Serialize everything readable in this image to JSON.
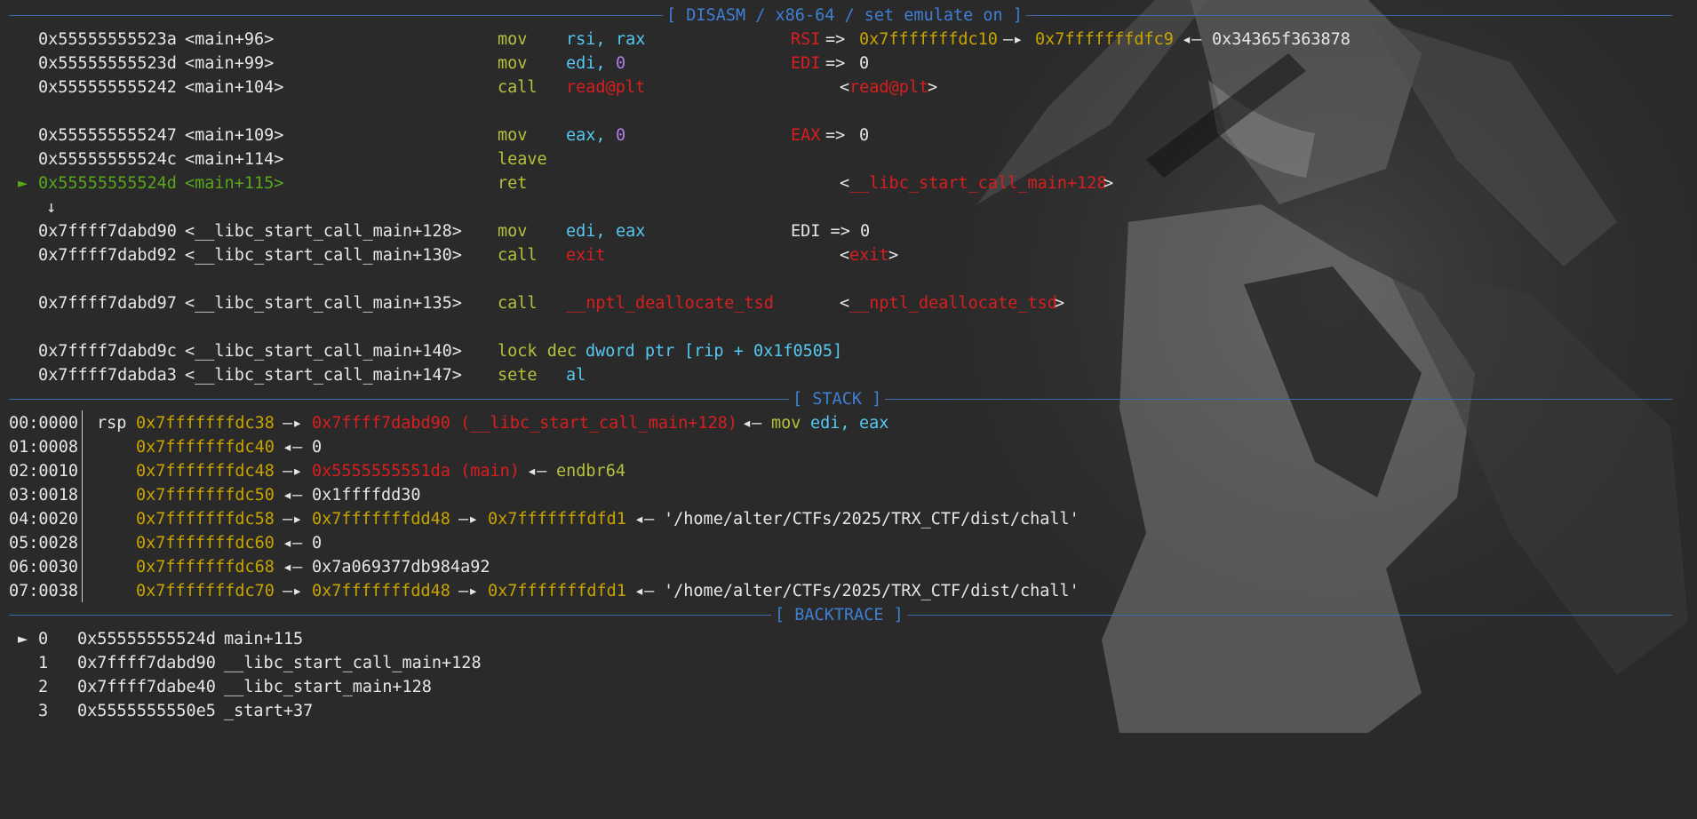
{
  "headers": {
    "disasm": "[ DISASM / x86-64 / set emulate on ]",
    "stack": "[ STACK ]",
    "backtrace": "[ BACKTRACE ]"
  },
  "colors": {
    "address_yellow": "#c8a400",
    "symbol_red": "#d81e1e",
    "current_green": "#58a61a",
    "register_cyan": "#55c8f0",
    "mnemonic_olive": "#b5c13a",
    "immediate_purple": "#b07ce8",
    "separator_blue": "#3f7fd4",
    "background": "#2a2a2b"
  },
  "disasm": {
    "current_marker": "►",
    "jump_arrow": "↓",
    "lines": [
      {
        "addr": "0x55555555523a",
        "sym": "<main+96>",
        "mnem": "mov",
        "op1": "rsi,",
        "op2": "rax",
        "ann_reg": "RSI",
        "ann_arrow": "=>",
        "ann_v1": "0x7fffffffdc10",
        "ann_a1": "—▸",
        "ann_v2": "0x7fffffffdfc9",
        "ann_a2": "◂—",
        "ann_v3": "0x34365f363878"
      },
      {
        "addr": "0x55555555523d",
        "sym": "<main+99>",
        "mnem": "mov",
        "op1": "edi,",
        "op2": "0",
        "ann_reg": "EDI",
        "ann_arrow": "=>",
        "ann_v1": "0"
      },
      {
        "addr": "0x555555555242",
        "sym": "<main+104>",
        "mnem": "call",
        "op1": "read@plt",
        "tgt_open": "<",
        "tgt": "read@plt",
        "tgt_close": ">"
      },
      {
        "addr": "0x555555555247",
        "sym": "<main+109>",
        "mnem": "mov",
        "op1": "eax,",
        "op2": "0",
        "ann_reg": "EAX",
        "ann_arrow": "=>",
        "ann_v1": "0"
      },
      {
        "addr": "0x55555555524c",
        "sym": "<main+114>",
        "mnem": "leave"
      },
      {
        "addr": "0x55555555524d",
        "sym": "<main+115>",
        "mnem": "ret",
        "tgt_open": "<",
        "tgt": "__libc_start_call_main+128",
        "tgt_close": ">"
      },
      {
        "addr": "0x7ffff7dabd90",
        "sym": "<__libc_start_call_main+128>",
        "mnem": "mov",
        "op1": "edi,",
        "op2": "eax",
        "ann_text": "EDI => 0"
      },
      {
        "addr": "0x7ffff7dabd92",
        "sym": "<__libc_start_call_main+130>",
        "mnem": "call",
        "op1": "exit",
        "tgt_open": "<",
        "tgt": "exit",
        "tgt_close": ">"
      },
      {
        "addr": "0x7ffff7dabd97",
        "sym": "<__libc_start_call_main+135>",
        "mnem": "call",
        "op1": "__nptl_deallocate_tsd",
        "tgt_open": "<",
        "tgt": "__nptl_deallocate_tsd",
        "tgt_close": ">"
      },
      {
        "addr": "0x7ffff7dabd9c",
        "sym": "<__libc_start_call_main+140>",
        "mnem": "lock dec",
        "op1": "dword ptr",
        "op2": "[rip + 0x1f0505]"
      },
      {
        "addr": "0x7ffff7dabda3",
        "sym": "<__libc_start_call_main+147>",
        "mnem": "sete",
        "op1": "al"
      }
    ]
  },
  "stack": {
    "rsp_label": "rsp",
    "rows": [
      {
        "off": "00:0000",
        "addr": "0x7fffffffdc38",
        "a1": "—▸",
        "v1": "0x7ffff7dabd90 (__libc_start_call_main+128)",
        "a2": "◂—",
        "v2a": "mov",
        "v2b": "edi,",
        "v2c": "eax"
      },
      {
        "off": "01:0008",
        "addr": "0x7fffffffdc40",
        "a1": "◂—",
        "v1": "0"
      },
      {
        "off": "02:0010",
        "addr": "0x7fffffffdc48",
        "a1": "—▸",
        "v1": "0x5555555551da (main)",
        "a2": "◂—",
        "v2a": "endbr64"
      },
      {
        "off": "03:0018",
        "addr": "0x7fffffffdc50",
        "a1": "◂—",
        "v1": "0x1ffffdd30"
      },
      {
        "off": "04:0020",
        "addr": "0x7fffffffdc58",
        "a1": "—▸",
        "v1": "0x7fffffffdd48",
        "a2": "—▸",
        "v2": "0x7fffffffdfd1",
        "a3": "◂—",
        "v3": "'/home/alter/CTFs/2025/TRX_CTF/dist/chall'"
      },
      {
        "off": "05:0028",
        "addr": "0x7fffffffdc60",
        "a1": "◂—",
        "v1": "0"
      },
      {
        "off": "06:0030",
        "addr": "0x7fffffffdc68",
        "a1": "◂—",
        "v1": "0x7a069377db984a92"
      },
      {
        "off": "07:0038",
        "addr": "0x7fffffffdc70",
        "a1": "—▸",
        "v1": "0x7fffffffdd48",
        "a2": "—▸",
        "v2": "0x7fffffffdfd1",
        "a3": "◂—",
        "v3": "'/home/alter/CTFs/2025/TRX_CTF/dist/chall'"
      }
    ]
  },
  "backtrace": {
    "marker": "►",
    "frames": [
      {
        "idx": "0",
        "addr": "0x55555555524d",
        "sym": "main+115"
      },
      {
        "idx": "1",
        "addr": "0x7ffff7dabd90",
        "sym": "__libc_start_call_main+128"
      },
      {
        "idx": "2",
        "addr": "0x7ffff7dabe40",
        "sym": "__libc_start_main+128"
      },
      {
        "idx": "3",
        "addr": "0x5555555550e5",
        "sym": "_start+37"
      }
    ]
  }
}
